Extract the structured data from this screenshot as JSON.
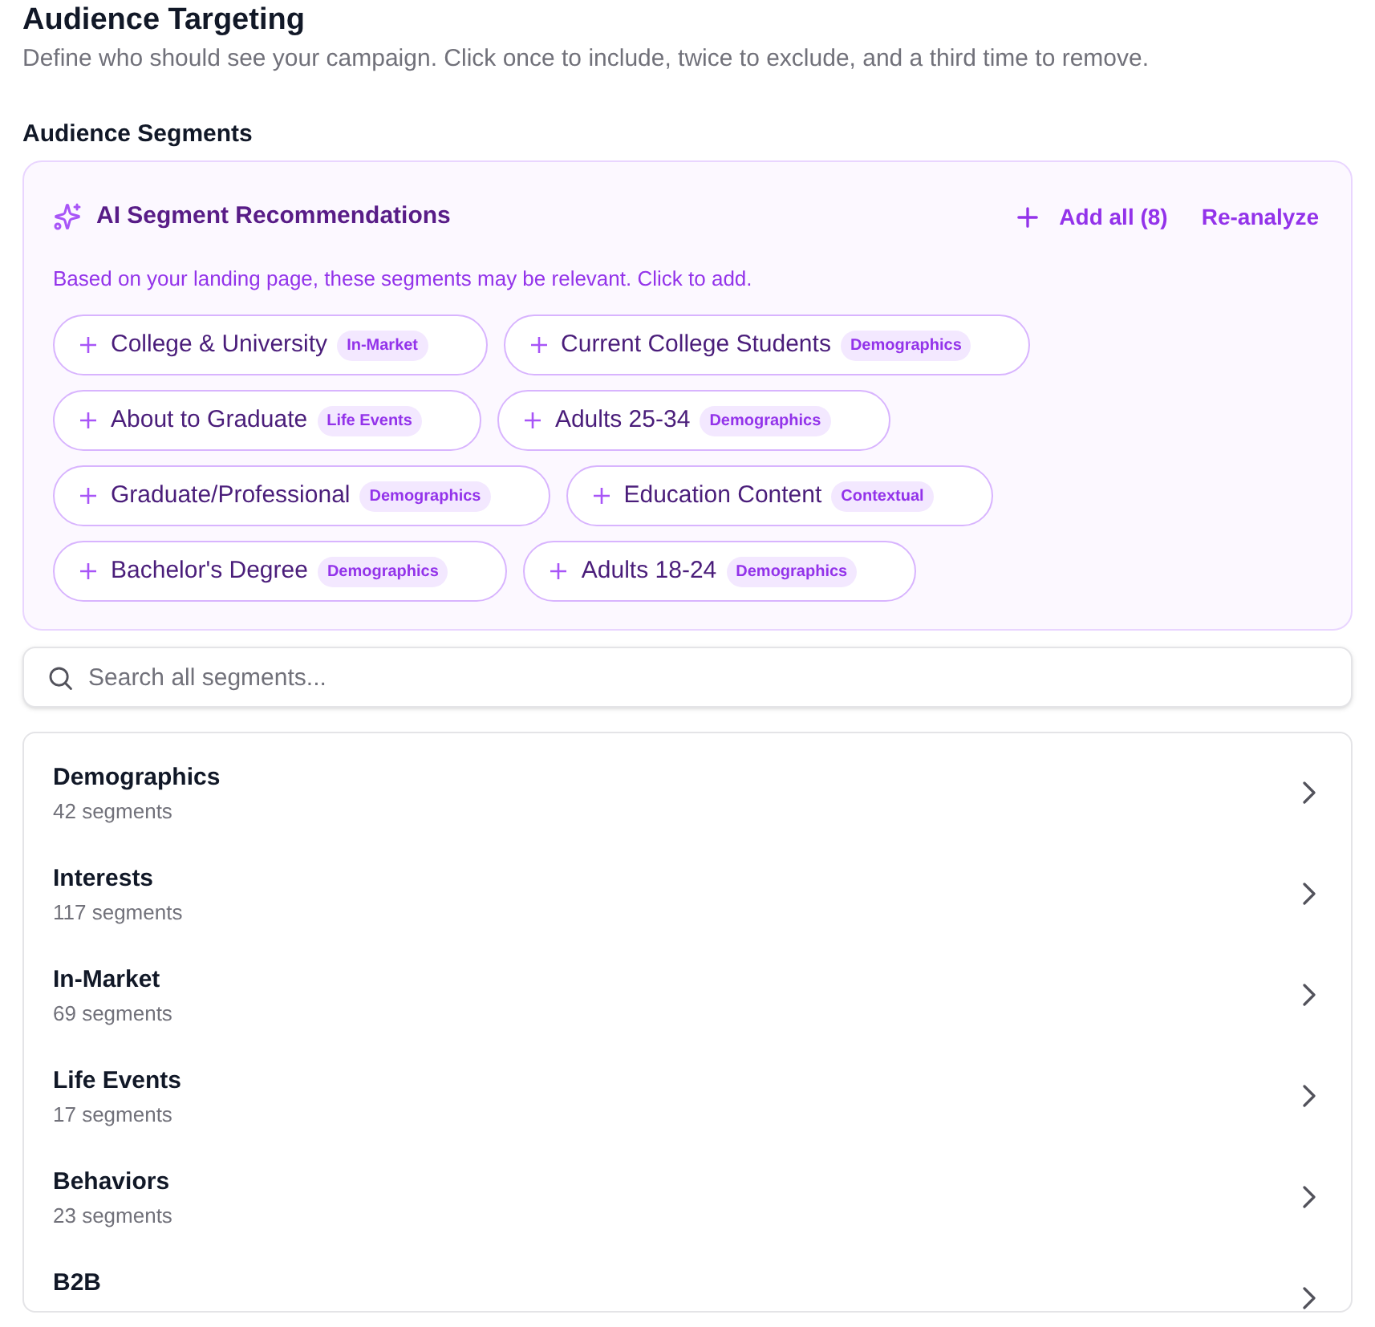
{
  "page": {
    "title": "Audience Targeting",
    "subtitle": "Define who should see your campaign. Click once to include, twice to exclude, and a third time to remove."
  },
  "section_title": "Audience Segments",
  "recommendations": {
    "title": "AI Segment Recommendations",
    "add_all": "Add all (8)",
    "reanalyze": "Re-analyze",
    "description": "Based on your landing page, these segments may be relevant. Click to add.",
    "chips": [
      {
        "label": "College & University",
        "category": "In-Market"
      },
      {
        "label": "Current College Students",
        "category": "Demographics"
      },
      {
        "label": "About to Graduate",
        "category": "Life Events"
      },
      {
        "label": "Adults 25-34",
        "category": "Demographics"
      },
      {
        "label": "Graduate/Professional",
        "category": "Demographics"
      },
      {
        "label": "Education Content",
        "category": "Contextual"
      },
      {
        "label": "Bachelor's Degree",
        "category": "Demographics"
      },
      {
        "label": "Adults 18-24",
        "category": "Demographics"
      }
    ]
  },
  "search": {
    "placeholder": "Search all segments..."
  },
  "categories": [
    {
      "name": "Demographics",
      "count": "42 segments"
    },
    {
      "name": "Interests",
      "count": "117 segments"
    },
    {
      "name": "In-Market",
      "count": "69 segments"
    },
    {
      "name": "Life Events",
      "count": "17 segments"
    },
    {
      "name": "Behaviors",
      "count": "23 segments"
    },
    {
      "name": "B2B"
    }
  ]
}
